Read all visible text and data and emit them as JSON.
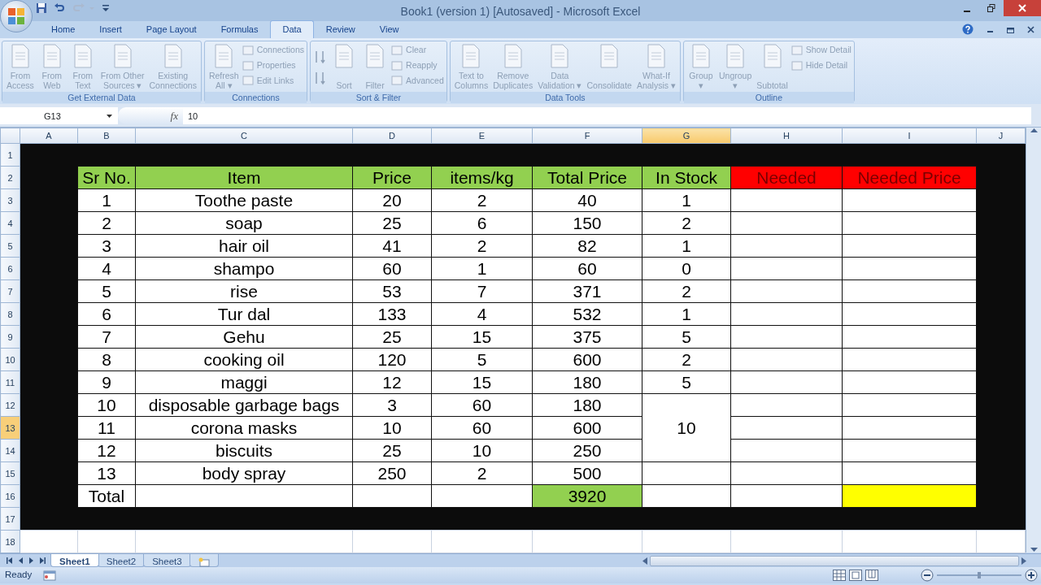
{
  "window": {
    "title": "Book1 (version 1) [Autosaved]  -  Microsoft Excel"
  },
  "ribbon_tabs": [
    {
      "label": "Home",
      "selected": false
    },
    {
      "label": "Insert",
      "selected": false
    },
    {
      "label": "Page Layout",
      "selected": false
    },
    {
      "label": "Formulas",
      "selected": false
    },
    {
      "label": "Data",
      "selected": true
    },
    {
      "label": "Review",
      "selected": false
    },
    {
      "label": "View",
      "selected": false
    }
  ],
  "ribbon_groups": [
    {
      "label": "Get External Data",
      "buttons": [
        {
          "kind": "large",
          "lines": [
            "From",
            "Access"
          ]
        },
        {
          "kind": "large",
          "lines": [
            "From",
            "Web"
          ]
        },
        {
          "kind": "large",
          "lines": [
            "From",
            "Text"
          ]
        },
        {
          "kind": "large",
          "lines": [
            "From Other",
            "Sources ▾"
          ]
        },
        {
          "kind": "large",
          "lines": [
            "Existing",
            "Connections"
          ]
        }
      ]
    },
    {
      "label": "Connections",
      "buttons": [
        {
          "kind": "large",
          "lines": [
            "Refresh",
            "All ▾"
          ]
        },
        {
          "kind": "stack",
          "items": [
            "Connections",
            "Properties",
            "Edit Links"
          ]
        }
      ]
    },
    {
      "label": "Sort & Filter",
      "buttons": [
        {
          "kind": "sortpair"
        },
        {
          "kind": "large",
          "lines": [
            "Sort"
          ]
        },
        {
          "kind": "large",
          "lines": [
            "Filter"
          ]
        },
        {
          "kind": "stack",
          "items": [
            "Clear",
            "Reapply",
            "Advanced"
          ]
        }
      ]
    },
    {
      "label": "Data Tools",
      "buttons": [
        {
          "kind": "large",
          "lines": [
            "Text to",
            "Columns"
          ]
        },
        {
          "kind": "large",
          "lines": [
            "Remove",
            "Duplicates"
          ]
        },
        {
          "kind": "large",
          "lines": [
            "Data",
            "Validation ▾"
          ]
        },
        {
          "kind": "large",
          "lines": [
            "Consolidate"
          ]
        },
        {
          "kind": "large",
          "lines": [
            "What-If",
            "Analysis ▾"
          ]
        }
      ]
    },
    {
      "label": "Outline",
      "buttons": [
        {
          "kind": "large",
          "lines": [
            "Group",
            "▾"
          ]
        },
        {
          "kind": "large",
          "lines": [
            "Ungroup",
            "▾"
          ]
        },
        {
          "kind": "large",
          "lines": [
            "Subtotal"
          ]
        },
        {
          "kind": "stack",
          "items": [
            "Show Detail",
            "Hide Detail"
          ]
        }
      ]
    }
  ],
  "formula_bar": {
    "name_box": "G13",
    "function_label": "fx",
    "formula": "10"
  },
  "column_headers": [
    {
      "label": "A",
      "selected": false
    },
    {
      "label": "B",
      "selected": false
    },
    {
      "label": "C",
      "selected": false
    },
    {
      "label": "D",
      "selected": false
    },
    {
      "label": "E",
      "selected": false
    },
    {
      "label": "F",
      "selected": false
    },
    {
      "label": "G",
      "selected": true
    },
    {
      "label": "H",
      "selected": false
    },
    {
      "label": "I",
      "selected": false
    },
    {
      "label": "J",
      "selected": false
    }
  ],
  "row_headers": [
    {
      "label": "1",
      "selected": false
    },
    {
      "label": "2",
      "selected": false
    },
    {
      "label": "3",
      "selected": false
    },
    {
      "label": "4",
      "selected": false
    },
    {
      "label": "5",
      "selected": false
    },
    {
      "label": "6",
      "selected": false
    },
    {
      "label": "7",
      "selected": false
    },
    {
      "label": "8",
      "selected": false
    },
    {
      "label": "9",
      "selected": false
    },
    {
      "label": "10",
      "selected": false
    },
    {
      "label": "11",
      "selected": false
    },
    {
      "label": "12",
      "selected": false
    },
    {
      "label": "13",
      "selected": true
    },
    {
      "label": "14",
      "selected": false
    },
    {
      "label": "15",
      "selected": false
    },
    {
      "label": "16",
      "selected": false
    },
    {
      "label": "17",
      "selected": false
    },
    {
      "label": "18",
      "selected": false
    }
  ],
  "table": {
    "columns": [
      {
        "label": "Sr No.",
        "color": "#92d050"
      },
      {
        "label": "Item",
        "color": "#92d050"
      },
      {
        "label": "Price",
        "color": "#92d050"
      },
      {
        "label": "items/kg",
        "color": "#92d050"
      },
      {
        "label": "Total Price",
        "color": "#92d050"
      },
      {
        "label": "In Stock",
        "color": "#92d050"
      },
      {
        "label": "Needed",
        "color": "#ff0000"
      },
      {
        "label": "Needed Price",
        "color": "#ff0000"
      }
    ],
    "rows": [
      {
        "sr": "1",
        "item": "Toothe paste",
        "price": "20",
        "qty": "2",
        "total": "40",
        "in_stock": "1"
      },
      {
        "sr": "2",
        "item": "soap",
        "price": "25",
        "qty": "6",
        "total": "150",
        "in_stock": "2"
      },
      {
        "sr": "3",
        "item": "hair oil",
        "price": "41",
        "qty": "2",
        "total": "82",
        "in_stock": "1"
      },
      {
        "sr": "4",
        "item": "shampo",
        "price": "60",
        "qty": "1",
        "total": "60",
        "in_stock": "0"
      },
      {
        "sr": "5",
        "item": "rise",
        "price": "53",
        "qty": "7",
        "total": "371",
        "in_stock": "2"
      },
      {
        "sr": "6",
        "item": "Tur dal",
        "price": "133",
        "qty": "4",
        "total": "532",
        "in_stock": "1"
      },
      {
        "sr": "7",
        "item": "Gehu",
        "price": "25",
        "qty": "15",
        "total": "375",
        "in_stock": "5"
      },
      {
        "sr": "8",
        "item": "cooking oil",
        "price": "120",
        "qty": "5",
        "total": "600",
        "in_stock": "2"
      },
      {
        "sr": "9",
        "item": "maggi",
        "price": "12",
        "qty": "15",
        "total": "180",
        "in_stock": "5"
      },
      {
        "sr": "10",
        "item": "disposable garbage bags",
        "price": "3",
        "qty": "60",
        "total": "180",
        "in_stock_merged": "10"
      },
      {
        "sr": "11",
        "item": "corona masks",
        "price": "10",
        "qty": "60",
        "total": "600"
      },
      {
        "sr": "12",
        "item": "biscuits",
        "price": "25",
        "qty": "10",
        "total": "250"
      },
      {
        "sr": "13",
        "item": "body spray",
        "price": "250",
        "qty": "2",
        "total": "500"
      }
    ],
    "total_row": {
      "label": "Total",
      "total": {
        "text": "3920",
        "color": "#92d050"
      },
      "needed_price": {
        "color": "#ffff00"
      }
    }
  },
  "sheet_tabs": [
    {
      "label": "Sheet1",
      "selected": true
    },
    {
      "label": "Sheet2",
      "selected": false
    },
    {
      "label": "Sheet3",
      "selected": false
    }
  ],
  "status_bar": {
    "text": "Ready",
    "zoom": {
      "level": 0.5
    }
  }
}
